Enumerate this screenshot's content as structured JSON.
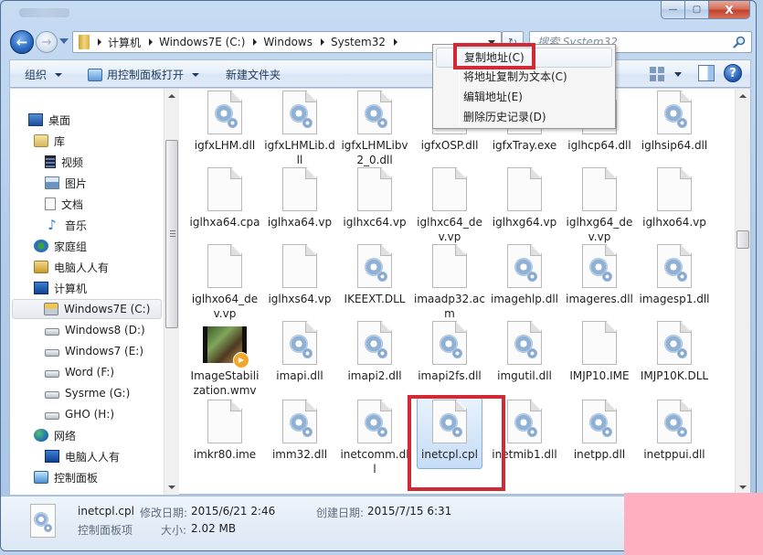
{
  "window": {
    "caption_buttons": {
      "minimize": "—",
      "maximize": "▢",
      "close": "X"
    }
  },
  "nav": {
    "back_icon": "←",
    "forward_icon": "→",
    "breadcrumbs": [
      "计算机",
      "Windows7E (C:)",
      "Windows",
      "System32"
    ],
    "refresh_icon": "↻",
    "search_placeholder": "搜索 System32"
  },
  "toolbar": {
    "organize": "组织",
    "open_with_control_panel": "用控制面板打开",
    "new_folder": "新建文件夹",
    "help_icon": "?"
  },
  "context_menu": {
    "items": [
      {
        "label": "复制地址(C)",
        "highlighted": true
      },
      {
        "label": "将地址复制为文本(C)",
        "highlighted": false
      },
      {
        "label": "编辑地址(E)",
        "highlighted": false
      },
      {
        "label": "删除历史记录(D)",
        "highlighted": false
      }
    ]
  },
  "sidebar": {
    "items": [
      {
        "label": "桌面",
        "icon": "desktop-icon"
      },
      {
        "label": "库",
        "icon": "library-icon"
      },
      {
        "label": "视频",
        "icon": "video-library-icon"
      },
      {
        "label": "图片",
        "icon": "pictures-icon"
      },
      {
        "label": "文档",
        "icon": "documents-icon"
      },
      {
        "label": "音乐",
        "icon": "music-icon"
      },
      {
        "label": "家庭组",
        "icon": "homegroup-icon"
      },
      {
        "label": "电脑人人有",
        "icon": "user-folder-icon"
      },
      {
        "label": "计算机",
        "icon": "computer-icon"
      },
      {
        "label": "Windows7E (C:)",
        "icon": "system-drive-icon",
        "selected": true
      },
      {
        "label": "Windows8 (D:)",
        "icon": "drive-icon"
      },
      {
        "label": "Windows7 (E:)",
        "icon": "drive-icon"
      },
      {
        "label": "Word (F:)",
        "icon": "drive-icon"
      },
      {
        "label": "Sysrme (G:)",
        "icon": "drive-icon"
      },
      {
        "label": "GHO (H:)",
        "icon": "drive-icon"
      },
      {
        "label": "网络",
        "icon": "network-icon"
      },
      {
        "label": "电脑人人有",
        "icon": "network-computer-icon"
      },
      {
        "label": "控制面板",
        "icon": "control-panel-icon"
      }
    ]
  },
  "files": [
    {
      "name": "igfxLHM.dll",
      "type": "dll"
    },
    {
      "name": "igfxLHMLib.dll",
      "type": "dll"
    },
    {
      "name": "igfxLHMLibv2_0.dll",
      "type": "dll"
    },
    {
      "name": "igfxOSP.dll",
      "type": "dll"
    },
    {
      "name": "igfxTray.exe",
      "type": "dll"
    },
    {
      "name": "iglhcp64.dll",
      "type": "dll"
    },
    {
      "name": "iglhsip64.dll",
      "type": "dll"
    },
    {
      "name": "iglhxa64.cpa",
      "type": "blank"
    },
    {
      "name": "iglhxa64.vp",
      "type": "blank"
    },
    {
      "name": "iglhxc64.vp",
      "type": "blank"
    },
    {
      "name": "iglhxc64_dev.vp",
      "type": "blank"
    },
    {
      "name": "iglhxg64.vp",
      "type": "blank"
    },
    {
      "name": "iglhxg64_dev.vp",
      "type": "blank"
    },
    {
      "name": "iglhxo64.vp",
      "type": "blank"
    },
    {
      "name": "iglhxo64_dev.vp",
      "type": "blank"
    },
    {
      "name": "iglhxs64.vp",
      "type": "blank"
    },
    {
      "name": "IKEEXT.DLL",
      "type": "dll"
    },
    {
      "name": "imaadp32.acm",
      "type": "blank"
    },
    {
      "name": "imagehlp.dll",
      "type": "dll"
    },
    {
      "name": "imageres.dll",
      "type": "dll"
    },
    {
      "name": "imagesp1.dll",
      "type": "dll"
    },
    {
      "name": "ImageStabilization.wmv",
      "type": "video"
    },
    {
      "name": "imapi.dll",
      "type": "dll"
    },
    {
      "name": "imapi2.dll",
      "type": "dll"
    },
    {
      "name": "imapi2fs.dll",
      "type": "dll"
    },
    {
      "name": "imgutil.dll",
      "type": "dll"
    },
    {
      "name": "IMJP10.IME",
      "type": "blank"
    },
    {
      "name": "IMJP10K.DLL",
      "type": "dll"
    },
    {
      "name": "imkr80.ime",
      "type": "blank"
    },
    {
      "name": "imm32.dll",
      "type": "dll"
    },
    {
      "name": "inetcomm.dll",
      "type": "dll"
    },
    {
      "name": "inetcpl.cpl",
      "type": "dll",
      "selected": true
    },
    {
      "name": "inetmib1.dll",
      "type": "dll"
    },
    {
      "name": "inetpp.dll",
      "type": "dll"
    },
    {
      "name": "inetppui.dll",
      "type": "dll"
    }
  ],
  "details": {
    "name": "inetcpl.cpl",
    "type": "控制面板项",
    "modified_label": "修改日期:",
    "modified_value": "2015/6/21 2:46",
    "created_label": "创建日期:",
    "created_value": "2015/7/15 6:31",
    "size_label": "大小:",
    "size_value": "2.02 MB"
  },
  "colors": {
    "highlight_red": "#d12a35",
    "selection_blue": "#c6dcf6",
    "watermark_pink": "#ffb0c0"
  }
}
